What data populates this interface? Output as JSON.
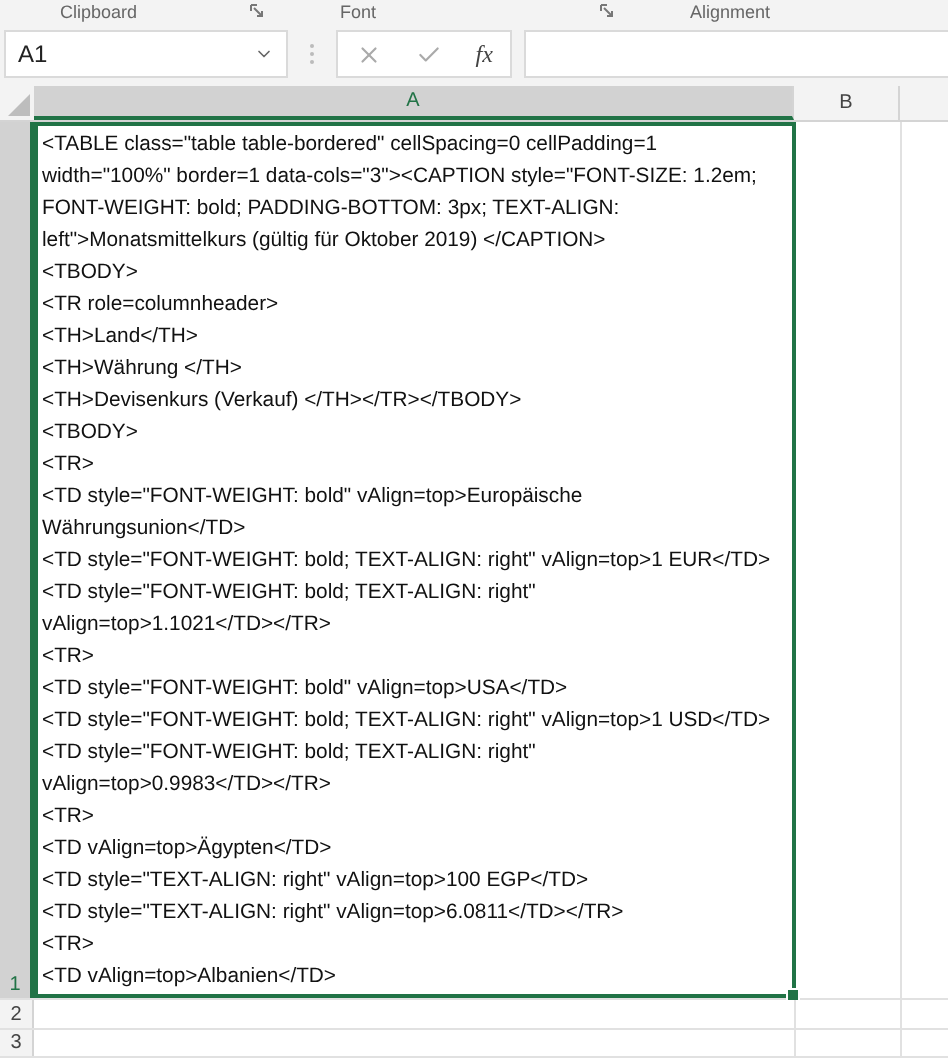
{
  "ribbon_groups": [
    {
      "label": "Clipboard",
      "launcher": true
    },
    {
      "label": "Font",
      "launcher": true
    },
    {
      "label": "Alignment",
      "launcher": false
    }
  ],
  "name_box": {
    "value": "A1"
  },
  "formula_bar": {
    "function_label": "fx"
  },
  "columns": [
    {
      "label": "A",
      "selected": true
    },
    {
      "label": "B",
      "selected": false
    }
  ],
  "rows": [
    {
      "label": "1",
      "selected": true
    },
    {
      "label": "2",
      "selected": false
    },
    {
      "label": "3",
      "selected": false
    }
  ],
  "active_cell": {
    "lines": [
      "<TABLE class=\"table table-bordered\" cellSpacing=0 cellPadding=1",
      "width=\"100%\" border=1 data-cols=\"3\"><CAPTION style=\"FONT-SIZE: 1.2em;",
      "FONT-WEIGHT: bold; PADDING-BOTTOM: 3px; TEXT-ALIGN:",
      "left\">Monatsmittelkurs (gültig für Oktober 2019) </CAPTION>",
      "<TBODY>",
      "<TR role=columnheader>",
      "<TH>Land</TH>",
      "<TH>Währung </TH>",
      "<TH>Devisenkurs (Verkauf) </TH></TR></TBODY>",
      "<TBODY>",
      "<TR>",
      "<TD style=\"FONT-WEIGHT: bold\" vAlign=top>Europäische",
      "Währungsunion</TD>",
      "<TD style=\"FONT-WEIGHT: bold; TEXT-ALIGN: right\" vAlign=top>1 EUR</TD>",
      "<TD style=\"FONT-WEIGHT: bold; TEXT-ALIGN: right\"",
      "vAlign=top>1.1021</TD></TR>",
      "<TR>",
      "<TD style=\"FONT-WEIGHT: bold\" vAlign=top>USA</TD>",
      "<TD style=\"FONT-WEIGHT: bold; TEXT-ALIGN: right\" vAlign=top>1 USD</TD>",
      "<TD style=\"FONT-WEIGHT: bold; TEXT-ALIGN: right\"",
      "vAlign=top>0.9983</TD></TR>",
      "<TR>",
      "<TD vAlign=top>Ägypten</TD>",
      "<TD style=\"TEXT-ALIGN: right\" vAlign=top>100 EGP</TD>",
      "<TD style=\"TEXT-ALIGN: right\" vAlign=top>6.0811</TD></TR>",
      "<TR>",
      "<TD vAlign=top>Albanien</TD>"
    ]
  }
}
